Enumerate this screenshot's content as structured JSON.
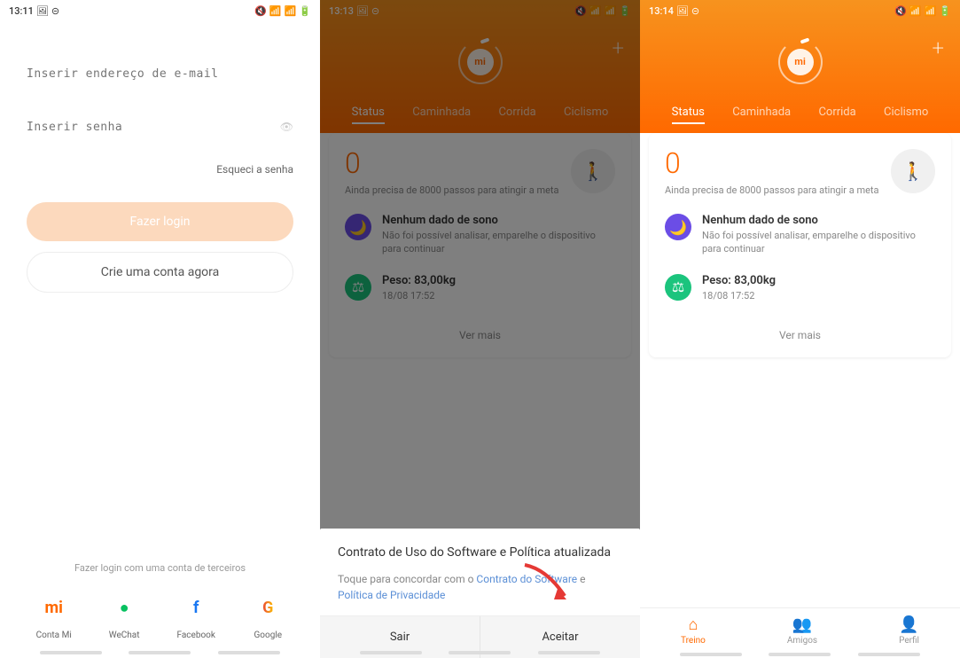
{
  "screen1": {
    "time": "13:11",
    "email_placeholder": "Inserir endereço de e-mail",
    "password_placeholder": "Inserir senha",
    "forgot": "Esqueci a senha",
    "login_btn": "Fazer login",
    "create_btn": "Crie uma conta agora",
    "third_party_title": "Fazer login com uma conta de terceiros",
    "social": [
      {
        "label": "Conta Mi",
        "glyph": "mi"
      },
      {
        "label": "WeChat",
        "glyph": "●"
      },
      {
        "label": "Facebook",
        "glyph": "f"
      },
      {
        "label": "Google",
        "glyph": "G"
      }
    ]
  },
  "screen2": {
    "time": "13:13",
    "tabs": [
      "Status",
      "Caminhada",
      "Corrida",
      "Ciclismo"
    ],
    "steps": "0",
    "steps_sub": "Ainda precisa de 8000 passos para atingir a meta",
    "sleep_title": "Nenhum dado de sono",
    "sleep_sub": "Não foi possível analisar, emparelhe o dispositivo para continuar",
    "weight_title": "Peso: 83,00kg",
    "weight_sub": "18/08 17:52",
    "ver_mais": "Ver mais",
    "dialog_title": "Contrato de Uso do Software e Política atualizada",
    "dialog_text_prefix": "Toque para concordar com o ",
    "dialog_link1": "Contrato do Software",
    "dialog_text_mid": " e ",
    "dialog_link2": "Política de Privacidade",
    "btn_exit": "Sair",
    "btn_accept": "Aceitar"
  },
  "screen3": {
    "time": "13:14",
    "tabs": [
      "Status",
      "Caminhada",
      "Corrida",
      "Ciclismo"
    ],
    "steps": "0",
    "steps_sub": "Ainda precisa de 8000 passos para atingir a meta",
    "sleep_title": "Nenhum dado de sono",
    "sleep_sub": "Não foi possível analisar, emparelhe o dispositivo para continuar",
    "weight_title": "Peso: 83,00kg",
    "weight_sub": "18/08 17:52",
    "ver_mais": "Ver mais",
    "nav": [
      {
        "label": "Treino",
        "icon": "⌂"
      },
      {
        "label": "Amigos",
        "icon": "👥"
      },
      {
        "label": "Perfil",
        "icon": "👤"
      }
    ]
  }
}
